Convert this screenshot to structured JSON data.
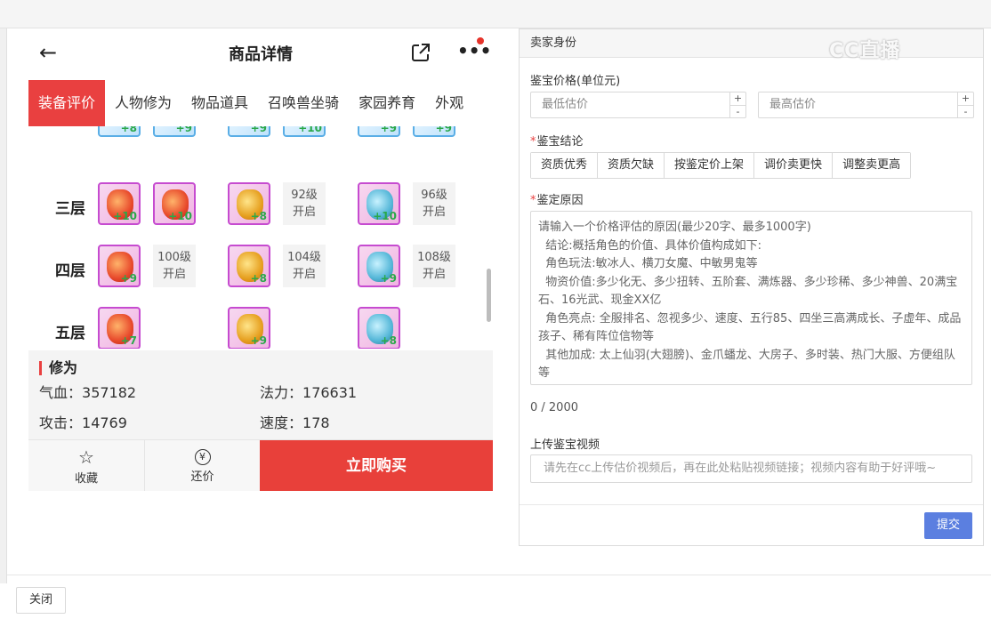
{
  "phone": {
    "title": "商品详情",
    "tabs": [
      "装备评价",
      "人物修为",
      "物品道具",
      "召唤兽坐骑",
      "家园养育",
      "外观"
    ],
    "rows": [
      {
        "label": "三层"
      },
      {
        "label": "四层"
      },
      {
        "label": "五层"
      }
    ],
    "slots": {
      "r1a": "+10",
      "r1b": "+10",
      "r1c": "+8",
      "r1d": "+10",
      "r2a": "+9",
      "r2b": "+8",
      "r2c": "+9",
      "r3a": "+7",
      "r3b": "+9",
      "r3c": "+8",
      "top_a": "+8",
      "top_b": "+9",
      "top_c": "+9",
      "top_d": "+10",
      "top_e": "+9",
      "top_f": "+9"
    },
    "locked": {
      "l92": [
        "92级",
        "开启"
      ],
      "l96": [
        "96级",
        "开启"
      ],
      "l100": [
        "100级",
        "开启"
      ],
      "l104": [
        "104级",
        "开启"
      ],
      "l108": [
        "108级",
        "开启"
      ]
    },
    "xiuwei": {
      "title": "修为",
      "stats": [
        {
          "label": "气血：",
          "value": "357182"
        },
        {
          "label": "法力：",
          "value": "176631"
        },
        {
          "label": "攻击：",
          "value": "14769"
        },
        {
          "label": "速度：",
          "value": "178"
        }
      ]
    },
    "bottom": {
      "favorite": "收藏",
      "bargain": "还价",
      "buy": "立即购买"
    }
  },
  "panel": {
    "header": "卖家身份",
    "watermark": "CC直播",
    "price_label": "鉴宝价格(单位元)",
    "min_placeholder": "最低估价",
    "max_placeholder": "最高估价",
    "conclusion_label": "鉴宝结论",
    "conclusion_options": [
      "资质优秀",
      "资质欠缺",
      "按鉴定价上架",
      "调价卖更快",
      "调整卖更高"
    ],
    "reason_label": "鉴定原因",
    "reason_placeholder": "请输入一个价格评估的原因(最少20字、最多1000字)\n  结论:概括角色的价值、具体价值构成如下:\n  角色玩法:敏冰人、横刀女魔、中敏男鬼等\n  物资价值:多少化无、多少扭转、五阶套、满炼器、多少珍稀、多少神兽、20满宝石、16光武、现金XX亿\n  角色亮点: 全服排名、忽视多少、速度、五行85、四坐三高满成长、子虚年、成品孩子、稀有阵位信物等\n  其他加成: 太上仙羽(大翅膀)、金爪蟠龙、大房子、多时装、热门大服、方便组队等",
    "counter": "0 / 2000",
    "video_label": "上传鉴宝视频",
    "video_placeholder": "请先在cc上传估价视频后，再在此处粘贴视频链接；视频内容有助于好评哦~",
    "submit": "提交"
  },
  "footer": {
    "close": "关闭"
  },
  "colors": {
    "accent_red": "#e94040",
    "submit_blue": "#5b7fe0",
    "slot_purple": "#c64bd0"
  }
}
